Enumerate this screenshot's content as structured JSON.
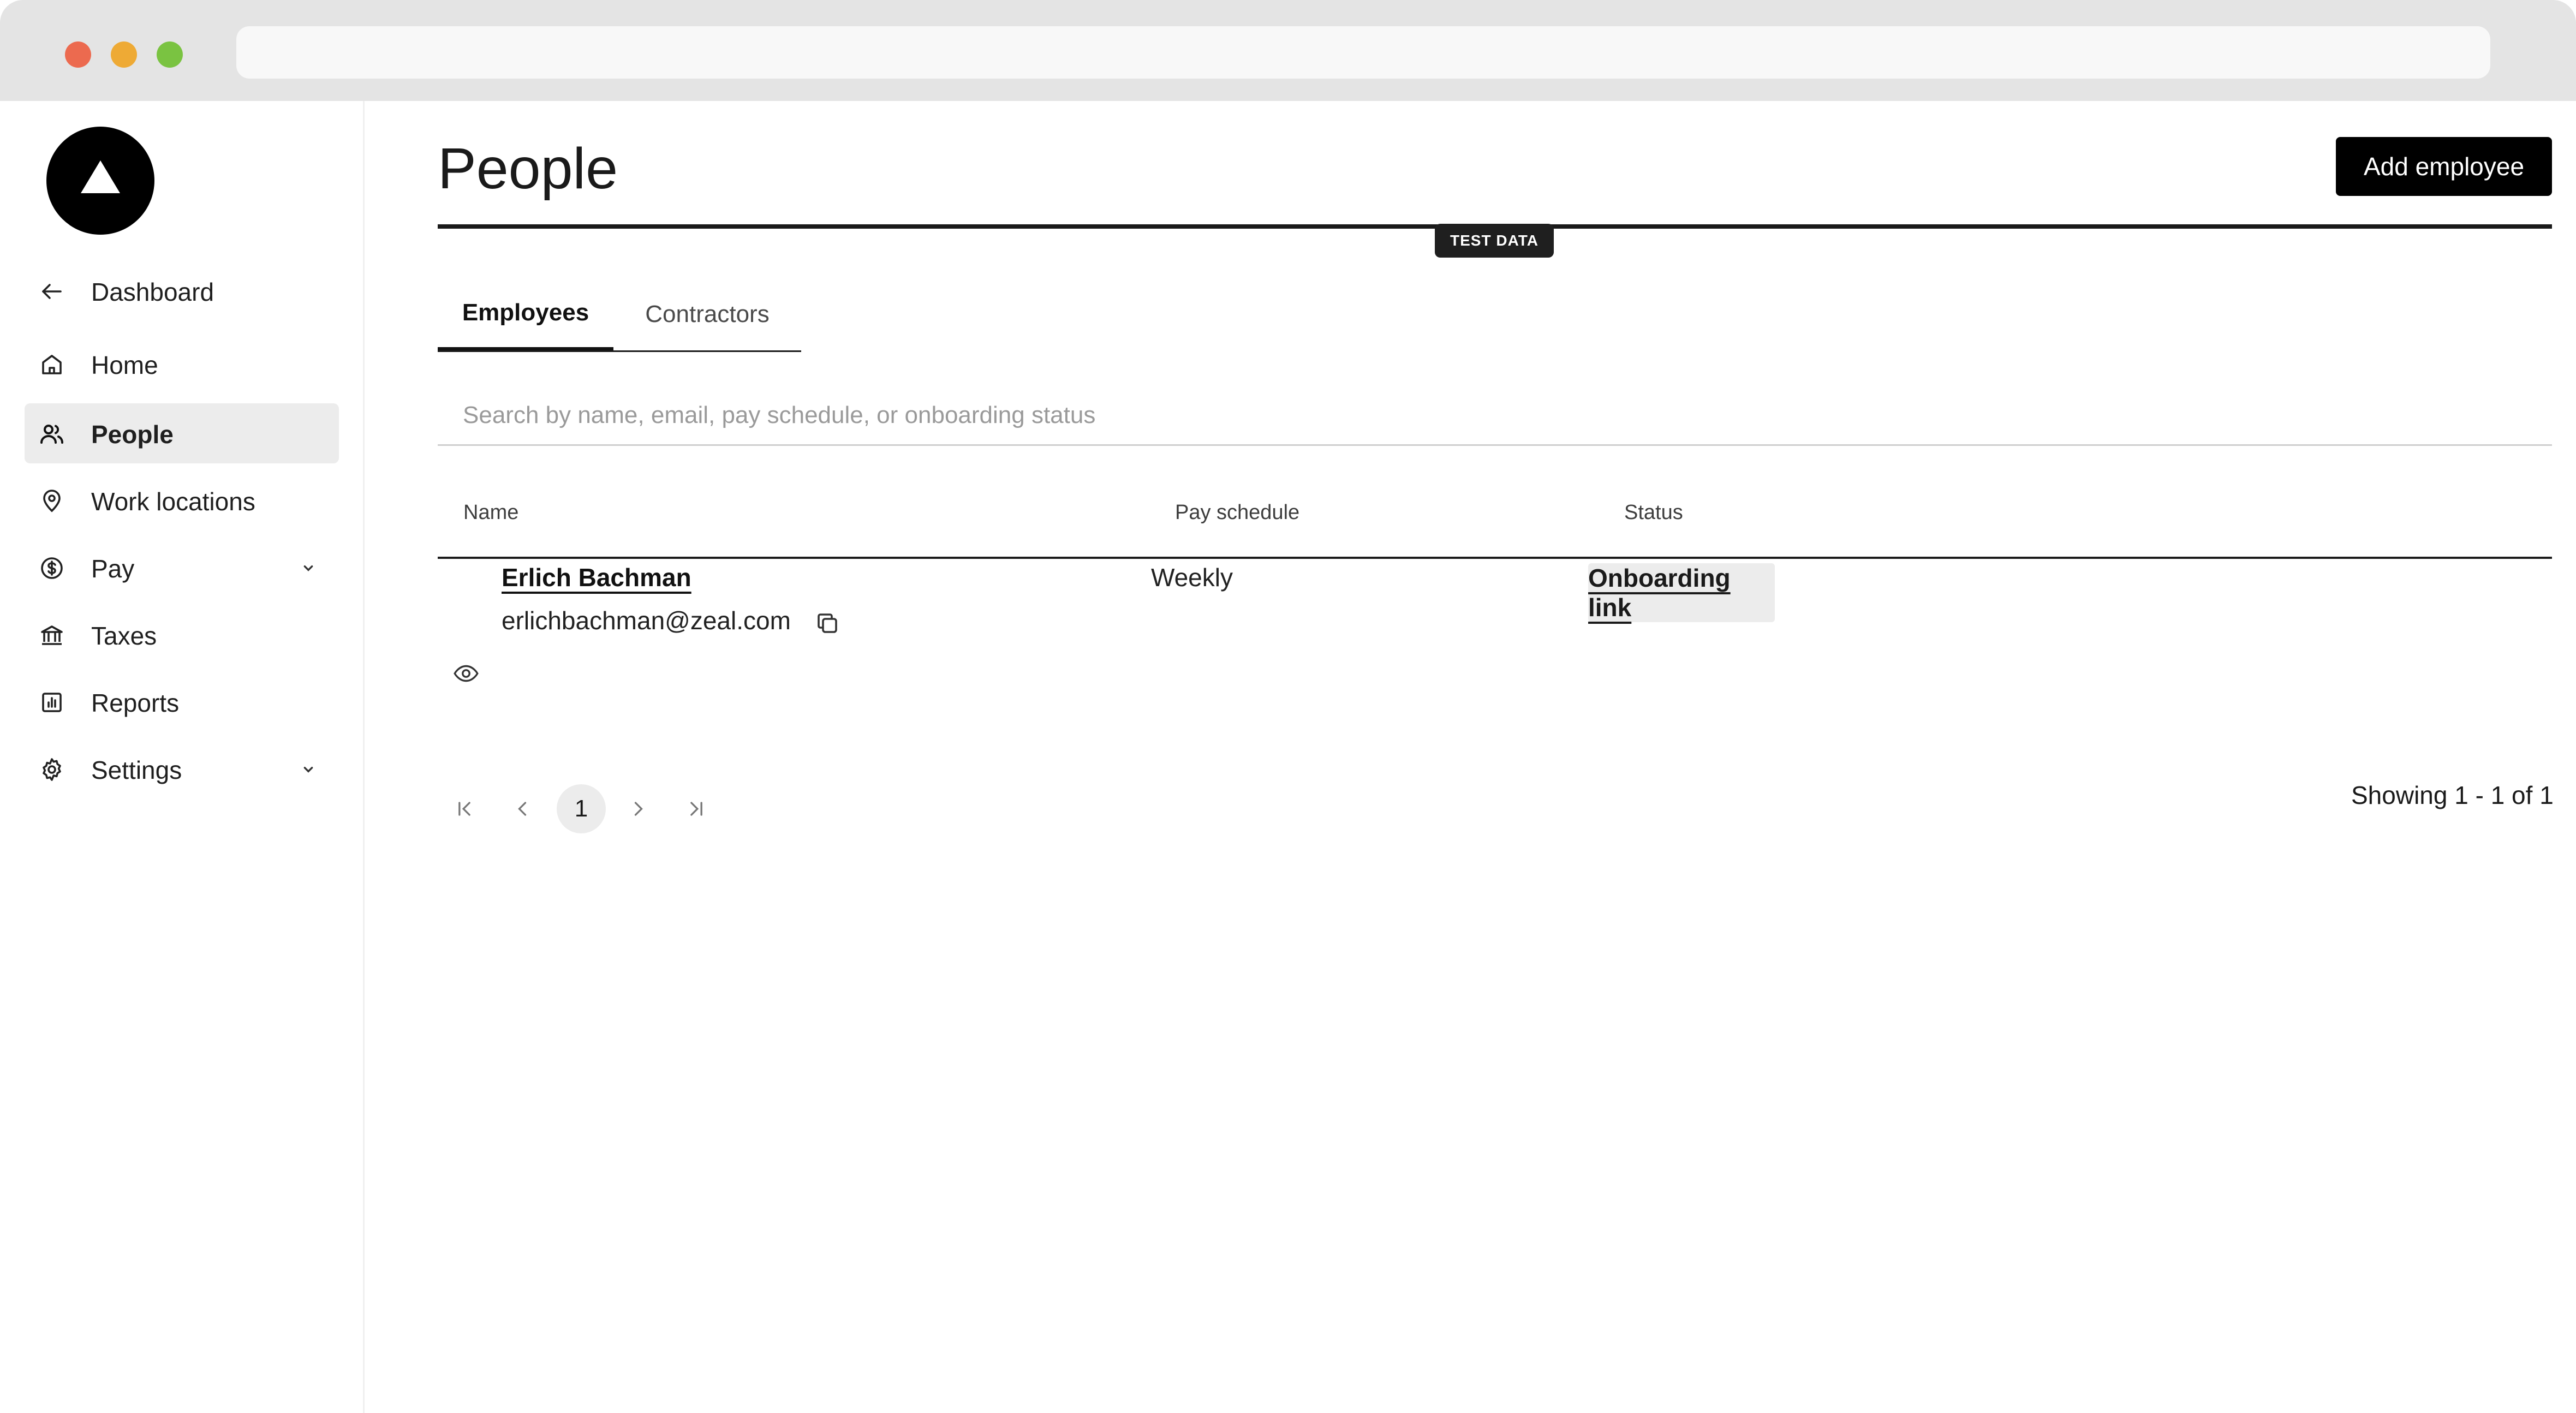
{
  "sidebar": {
    "items": [
      {
        "label": "Dashboard",
        "icon": "arrow-left-icon"
      },
      {
        "label": "Home",
        "icon": "home-icon"
      },
      {
        "label": "People",
        "icon": "people-icon",
        "active": true
      },
      {
        "label": "Work locations",
        "icon": "location-pin-icon"
      },
      {
        "label": "Pay",
        "icon": "dollar-circle-icon",
        "expandable": true
      },
      {
        "label": "Taxes",
        "icon": "bank-icon"
      },
      {
        "label": "Reports",
        "icon": "chart-icon"
      },
      {
        "label": "Settings",
        "icon": "gear-icon",
        "expandable": true
      }
    ]
  },
  "header": {
    "title": "People",
    "add_button": "Add employee",
    "badge": "TEST DATA"
  },
  "tabs": [
    {
      "label": "Employees",
      "active": true
    },
    {
      "label": "Contractors",
      "active": false
    }
  ],
  "search": {
    "placeholder": "Search by name, email, pay schedule, or onboarding status"
  },
  "table": {
    "columns": [
      "Name",
      "Pay schedule",
      "Status"
    ],
    "rows": [
      {
        "name": "Erlich Bachman",
        "email": "erlichbachman@zeal.com",
        "pay_schedule": "Weekly",
        "status": "Onboarding link"
      }
    ]
  },
  "pagination": {
    "current_page": "1",
    "summary": "Showing 1 - 1 of 1"
  },
  "colors": {
    "accent": "#000000",
    "active_bg": "#ececec"
  }
}
